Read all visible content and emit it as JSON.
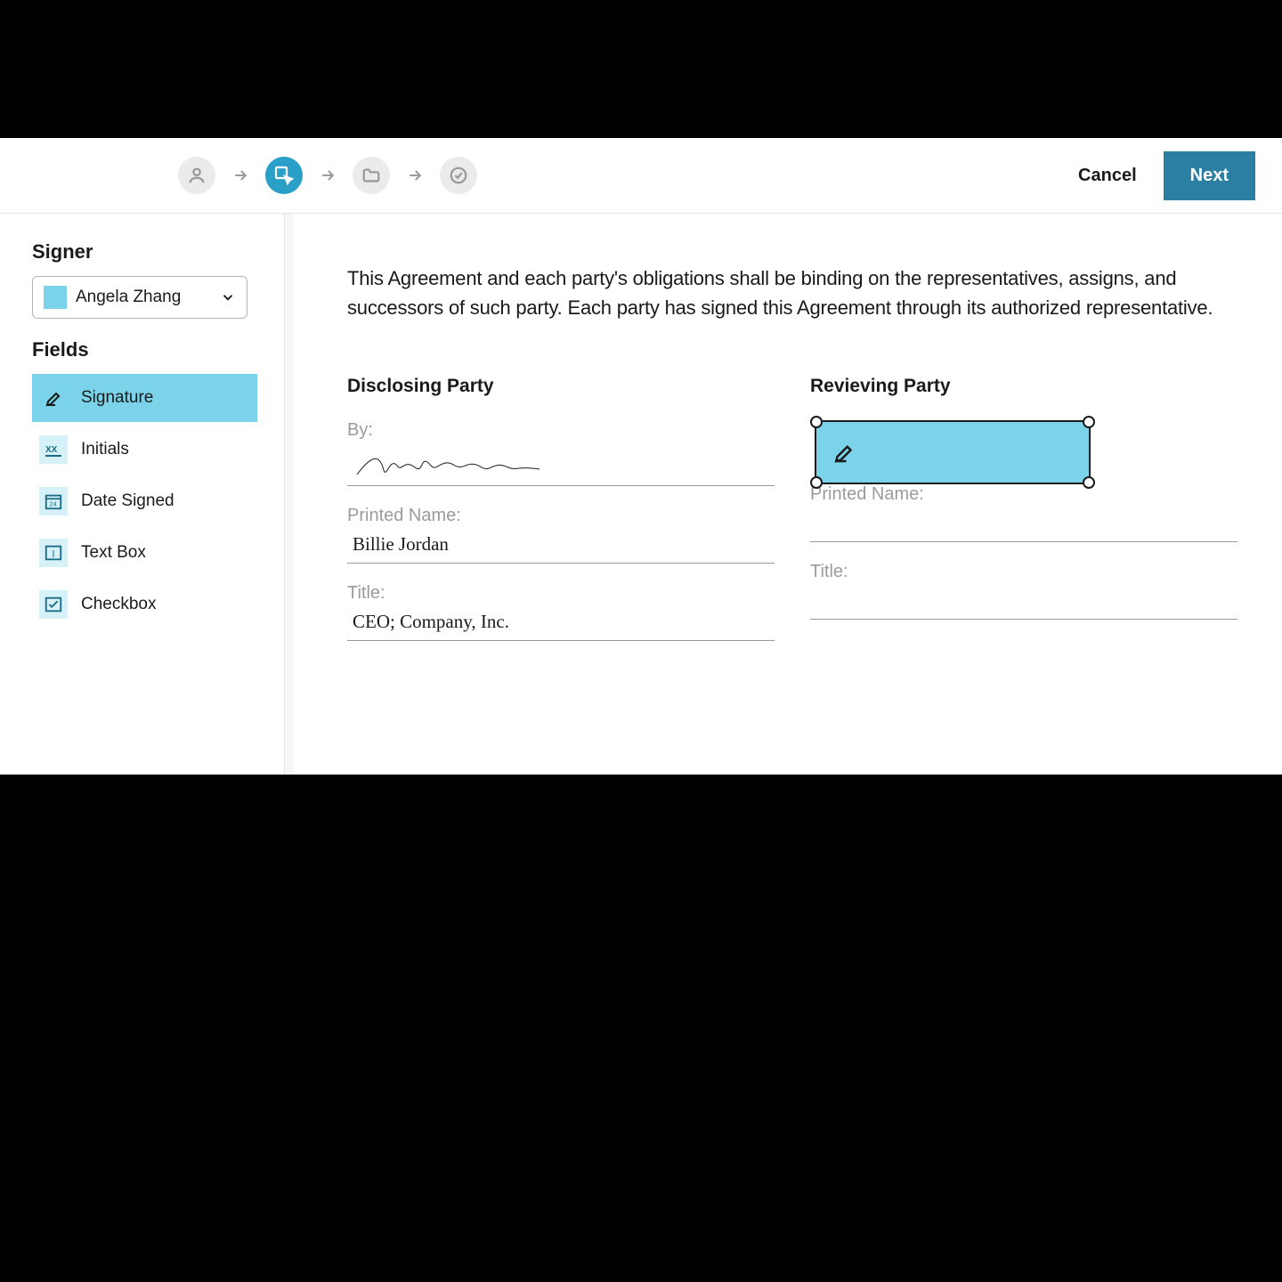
{
  "header": {
    "cancel_label": "Cancel",
    "next_label": "Next"
  },
  "sidebar": {
    "signer_heading": "Signer",
    "signer_selected": "Angela Zhang",
    "fields_heading": "Fields",
    "fields": [
      {
        "label": "Signature",
        "icon": "signature"
      },
      {
        "label": "Initials",
        "icon": "initials"
      },
      {
        "label": "Date Signed",
        "icon": "date"
      },
      {
        "label": "Text Box",
        "icon": "textbox"
      },
      {
        "label": "Checkbox",
        "icon": "checkbox"
      }
    ]
  },
  "document": {
    "paragraph": "This Agreement and each party's obligations shall be binding on the representatives, assigns, and successors of such party. Each party has signed this Agreement through its authorized representative.",
    "disclosing": {
      "title": "Disclosing Party",
      "by_label": "By:",
      "printed_name_label": "Printed Name:",
      "printed_name_value": "Billie Jordan",
      "title_label": "Title:",
      "title_value": "CEO; Company, Inc."
    },
    "receiving": {
      "title": "Revieving Party",
      "printed_name_label": "Printed Name:",
      "title_label": "Title:"
    }
  }
}
